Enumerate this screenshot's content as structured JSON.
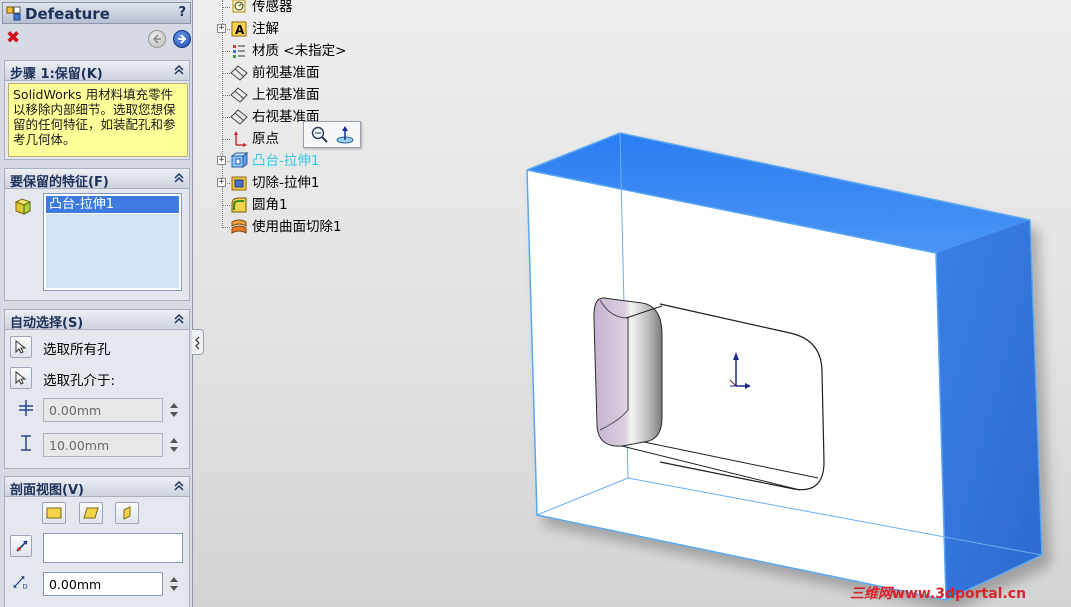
{
  "property_manager": {
    "title": "Defeature",
    "help": "?",
    "ok_symbol": "✖",
    "step_group": {
      "label": "步骤 1:保留(K)",
      "message": "SolidWorks 用材料填充零件以移除内部细节。选取您想保留的任何特征，如装配孔和参考几何体。"
    },
    "keep_group": {
      "label": "要保留的特征(F)",
      "items": [
        "凸台-拉伸1"
      ]
    },
    "auto_group": {
      "label": "自动选择(S)",
      "select_all_holes": "选取所有孔",
      "select_holes_between": "选取孔介于:",
      "min_value": "0.00mm",
      "max_value": "10.00mm"
    },
    "section_group": {
      "label": "剖面视图(V)",
      "offset_value": "0.00mm"
    }
  },
  "tree": {
    "items": [
      {
        "label": "传感器",
        "icon": "sensor-icon",
        "expandable": false
      },
      {
        "label": "注解",
        "icon": "annotation-icon",
        "expandable": true
      },
      {
        "label": "材质 <未指定>",
        "icon": "material-icon",
        "expandable": false
      },
      {
        "label": "前视基准面",
        "icon": "plane-icon",
        "expandable": false
      },
      {
        "label": "上视基准面",
        "icon": "plane-icon",
        "expandable": false
      },
      {
        "label": "右视基准面",
        "icon": "plane-icon",
        "expandable": false
      },
      {
        "label": "原点",
        "icon": "origin-icon",
        "expandable": false
      },
      {
        "label": "凸台-拉伸1",
        "icon": "boss-extrude-icon",
        "expandable": true,
        "highlighted": true
      },
      {
        "label": "切除-拉伸1",
        "icon": "cut-extrude-icon",
        "expandable": true
      },
      {
        "label": "圆角1",
        "icon": "fillet-icon",
        "expandable": false
      },
      {
        "label": "使用曲面切除1",
        "icon": "surface-cut-icon",
        "expandable": false
      }
    ]
  },
  "colors": {
    "highlight_blue": "#3a87ee",
    "tree_highlight": "#35c9e8",
    "watermark_red": "#d8232a"
  },
  "watermark": {
    "cn": "三维网",
    "url": "www.3dportal.cn"
  }
}
